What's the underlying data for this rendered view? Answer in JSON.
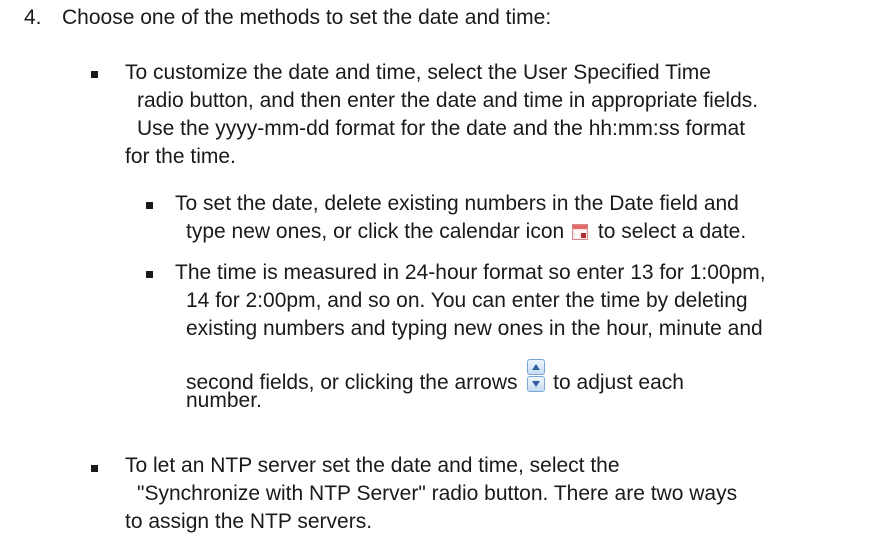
{
  "step": {
    "number": "4.",
    "text": "Choose one of the methods to set the date and time:"
  },
  "items": [
    {
      "lines": [
        "To customize the date and time, select the User Specified Time",
        "radio button, and then enter the date and time in appropriate fields.",
        "Use the yyyy-mm-dd format for the date and the hh:mm:ss format",
        "for the time."
      ]
    },
    {
      "lines_a": "To set the date, delete existing numbers in the Date field and",
      "line_b_before": "type new ones, or click the calendar icon",
      "line_b_after": "to select a date.",
      "icon": "calendar-icon"
    },
    {
      "lines": [
        "The time is measured in 24-hour format so enter 13 for 1:00pm,",
        "14 for 2:00pm, and so on. You can enter the time by deleting",
        "existing numbers and typing new ones in the hour, minute and"
      ],
      "line_d_before": "second fields, or clicking the arrows",
      "line_d_after": "to adjust each",
      "line_e": "number.",
      "icon": "spinner-arrows-icon"
    },
    {
      "lines": [
        "To let an NTP server set the date and time, select the",
        "\"Synchronize with NTP Server\" radio button. There are two ways",
        "to assign the NTP servers."
      ]
    }
  ]
}
